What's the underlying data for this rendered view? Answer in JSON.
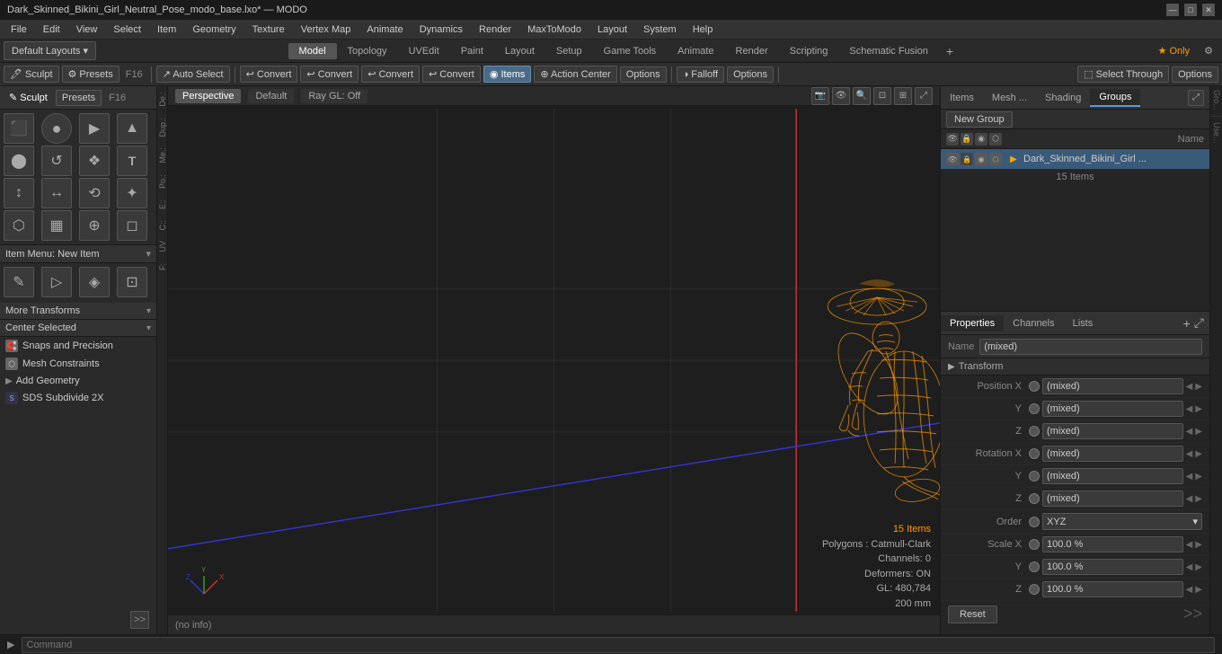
{
  "titlebar": {
    "title": "Dark_Skinned_Bikini_Girl_Neutral_Pose_modo_base.lxo* — MODO",
    "minimize": "—",
    "maximize": "□",
    "close": "✕"
  },
  "menubar": {
    "items": [
      "File",
      "Edit",
      "View",
      "Select",
      "Item",
      "Geometry",
      "Texture",
      "Vertex Map",
      "Animate",
      "Dynamics",
      "Render",
      "MaxToModo",
      "Layout",
      "System",
      "Help"
    ]
  },
  "layout_tabs": {
    "left_label": "Default Layouts ▾",
    "tabs": [
      "Model",
      "Topology",
      "UVEdit",
      "Paint",
      "Layout",
      "Setup",
      "Game Tools",
      "Animate",
      "Render",
      "Scripting",
      "Schematic Fusion"
    ],
    "active": "Model",
    "plus": "+",
    "star_label": "★ Only",
    "gear": "⚙"
  },
  "toolbar": {
    "sculpt_label": "Sculpt",
    "presets_label": "Presets",
    "f16_label": "F16",
    "auto_select": "Auto Select",
    "convert_btns": [
      "Convert",
      "Convert",
      "Convert",
      "Convert"
    ],
    "items_label": "Items",
    "action_center": "Action Center",
    "options": "Options",
    "falloff": "Falloff",
    "options2": "Options",
    "select_through": "Select Through",
    "options3": "Options"
  },
  "left_panel": {
    "tool_icons": [
      "⬛",
      "●",
      "▶",
      "▲",
      "⬤",
      "↺",
      "❖",
      "T",
      "↕",
      "↔",
      "⟲",
      "✦",
      "⬡",
      "▦",
      "⊕",
      "◻"
    ],
    "item_menu_label": "Item Menu: New Item",
    "tool_icons2": [
      "✎",
      "▷",
      "◈",
      "⊡"
    ],
    "more_transforms": "More Transforms",
    "center_selected": "Center Selected",
    "snaps_label": "Snaps and Precision",
    "mesh_label": "Mesh Constraints",
    "add_geometry": "Add Geometry",
    "sds_label": "SDS Subdivide 2X",
    "expand_label": ">>"
  },
  "vside_labels": [
    "De.:",
    "Dup.:",
    "Me.:",
    "Po.:",
    "E::",
    "C::",
    "UV",
    "F:"
  ],
  "viewport": {
    "tabs": [
      "Perspective",
      "Default",
      "Ray GL: Off"
    ],
    "active_tab": "Perspective",
    "info_items": "15 Items",
    "info_polygons": "Polygons : Catmull-Clark",
    "info_channels": "Channels: 0",
    "info_deformers": "Deformers: ON",
    "info_gl": "GL: 480,784",
    "info_size": "200 mm",
    "footer_text": "(no info)"
  },
  "right_panel": {
    "scene_tabs": [
      "Items",
      "Mesh ...",
      "Shading",
      "Groups"
    ],
    "active_scene_tab": "Groups",
    "new_group_label": "New Group",
    "col_name": "Name",
    "scene_items": [
      {
        "name": "Dark_Skinned_Bikini_Girl ...",
        "sub_count": "15 Items",
        "selected": true
      }
    ]
  },
  "properties": {
    "tabs": [
      "Properties",
      "Channels",
      "Lists"
    ],
    "active_tab": "Properties",
    "plus_label": "+",
    "name_label": "Name",
    "name_value": "(mixed)",
    "transform_header": "Transform",
    "fields": [
      {
        "label": "Position X",
        "value": "(mixed)"
      },
      {
        "label": "Y",
        "value": "(mixed)"
      },
      {
        "label": "Z",
        "value": "(mixed)"
      },
      {
        "label": "Rotation X",
        "value": "(mixed)"
      },
      {
        "label": "Y",
        "value": "(mixed)"
      },
      {
        "label": "Z",
        "value": "(mixed)"
      },
      {
        "label": "Order",
        "value": "XYZ",
        "is_dropdown": true
      },
      {
        "label": "Scale X",
        "value": "100.0 %"
      },
      {
        "label": "Y",
        "value": "100.0 %"
      },
      {
        "label": "Z",
        "value": "100.0 %"
      }
    ],
    "reset_label": "Reset"
  },
  "right_strip": {
    "labels": [
      "Gro...",
      "Use..."
    ]
  },
  "statusbar": {
    "info_text": "(no info)",
    "command_placeholder": "Command"
  },
  "colors": {
    "accent_orange": "#ff9900",
    "accent_blue": "#3a6a9a",
    "bg_dark": "#1e1e1e",
    "bg_mid": "#2a2a2a",
    "bg_light": "#3a3a3a",
    "text_normal": "#cccccc",
    "text_dim": "#888888"
  }
}
